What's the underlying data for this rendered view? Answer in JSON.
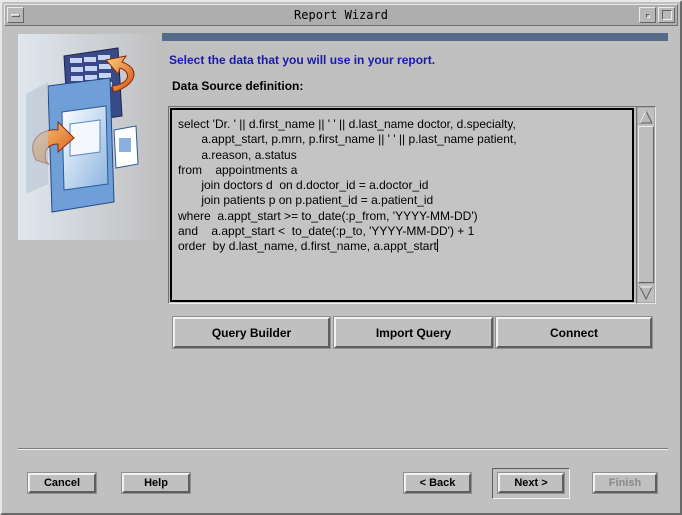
{
  "window": {
    "title": "Report Wizard"
  },
  "content": {
    "heading": "Select the data that you will use in your report.",
    "data_source_label": "Data Source definition:",
    "sql_lines": [
      "select 'Dr. ' || d.first_name || ' ' || d.last_name doctor, d.specialty,",
      "       a.appt_start, p.mrn, p.first_name || ' ' || p.last_name patient,",
      "       a.reason, a.status",
      "from    appointments a",
      "       join doctors d  on d.doctor_id = a.doctor_id",
      "       join patients p on p.patient_id = a.patient_id",
      "where  a.appt_start >= to_date(:p_from, 'YYYY-MM-DD')",
      "and    a.appt_start <  to_date(:p_to, 'YYYY-MM-DD') + 1",
      "order  by d.last_name, d.first_name, a.appt_start"
    ]
  },
  "query_buttons": {
    "query_builder": "Query Builder",
    "import_query": "Import Query",
    "connect": "Connect"
  },
  "footer_buttons": {
    "cancel": "Cancel",
    "help": "Help",
    "back": "< Back",
    "next": "Next >",
    "finish": "Finish"
  },
  "colors": {
    "heading_text": "#1a1aa8",
    "header_bar": "#566a8a",
    "dialog_background": "#c0c0c0",
    "disabled_text": "#8a8a8a"
  },
  "icons": {
    "wizard_illustration": "report-wizard-illustration",
    "scroll_up": "triangle-up-icon",
    "scroll_down": "triangle-down-icon"
  }
}
